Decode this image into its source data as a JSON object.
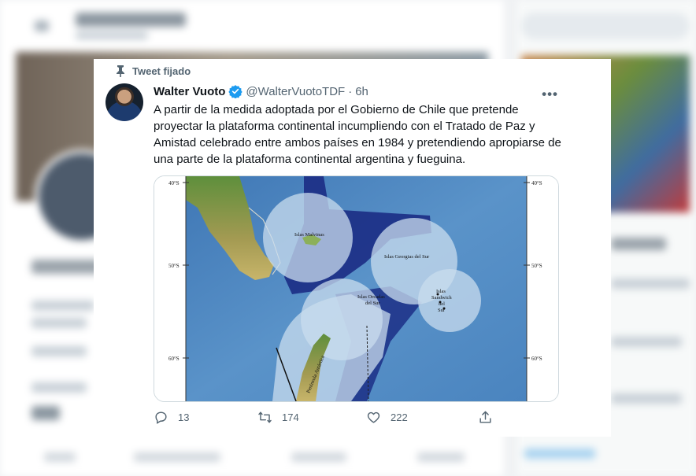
{
  "pinned_label": "Tweet fijado",
  "author": {
    "name": "Walter Vuoto",
    "handle": "@WalterVuotoTDF",
    "time": "6h"
  },
  "tweet_text": "A partir de la medida adoptada por el Gobierno de Chile que pretende proyectar la plataforma continental incumpliendo con el Tratado de Paz y Amistad celebrado entre ambos países en 1984 y pretendiendo apropiarse de una parte de la plataforma continental argentina y fueguina.",
  "map": {
    "labels": {
      "malvinas": "Islas Malvinas",
      "georgias": "Islas Georgias del Sur",
      "orcadas_1": "Islas Orcadas",
      "orcadas_2": "del Sur",
      "sandwich_1": "Islas",
      "sandwich_2": "Sandwich",
      "sandwich_3": "del",
      "sandwich_4": "Sur",
      "peninsula": "Península Antártica"
    },
    "lat_labels_left": [
      "40°S",
      "50°S",
      "60°S"
    ],
    "lat_labels_right": [
      "40°S",
      "50°S",
      "60°S"
    ]
  },
  "actions": {
    "replies": "13",
    "retweets": "174",
    "likes": "222"
  },
  "colors": {
    "verified": "#1d9bf0",
    "text": "#0f1419",
    "muted": "#536471"
  }
}
